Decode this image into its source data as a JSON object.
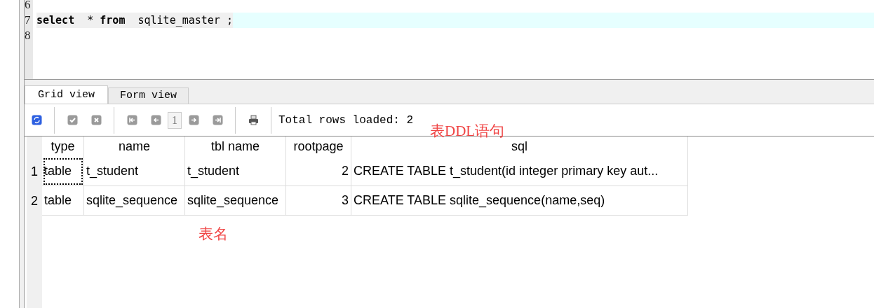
{
  "editor": {
    "lines": [
      {
        "number": "6",
        "current": false
      },
      {
        "number": "7",
        "current": true,
        "segments": [
          {
            "kind": "keyword",
            "text": "select"
          },
          {
            "kind": "plain",
            "text": "  * "
          },
          {
            "kind": "keyword",
            "text": "from"
          },
          {
            "kind": "plain",
            "text": "  sqlite_master ;"
          }
        ]
      },
      {
        "number": "8",
        "current": false
      }
    ]
  },
  "tabs": [
    {
      "label": "Grid view",
      "selected": true
    },
    {
      "label": "Form view",
      "selected": false
    }
  ],
  "toolbar": {
    "groups": [
      {
        "buttons": [
          {
            "kind": "refresh",
            "disabled": false
          }
        ]
      },
      {
        "buttons": [
          {
            "kind": "check",
            "disabled": true
          },
          {
            "kind": "cancel",
            "disabled": true
          }
        ]
      },
      {
        "buttons": [
          {
            "kind": "first",
            "disabled": true
          },
          {
            "kind": "prev",
            "disabled": true
          },
          {
            "kind": "page",
            "disabled": true,
            "value": "1"
          },
          {
            "kind": "next",
            "disabled": true
          },
          {
            "kind": "last",
            "disabled": true
          }
        ]
      },
      {
        "buttons": [
          {
            "kind": "print",
            "disabled": false
          }
        ]
      }
    ],
    "status": "Total rows loaded: 2"
  },
  "grid": {
    "columns": [
      "type",
      "name",
      "tbl name",
      "rootpage",
      "sql"
    ],
    "rows": [
      {
        "number": "1",
        "cells": [
          {
            "text": "table",
            "focused": true
          },
          {
            "text": "t_student",
            "focused": false
          },
          {
            "text": "t_student",
            "focused": false
          },
          {
            "text": "2",
            "focused": false
          },
          {
            "text": "CREATE TABLE t_student(id  integer primary key aut...",
            "focused": false
          }
        ]
      },
      {
        "number": "2",
        "cells": [
          {
            "text": "table",
            "focused": false
          },
          {
            "text": "sqlite_sequence",
            "focused": false
          },
          {
            "text": "sqlite_sequence",
            "focused": false
          },
          {
            "text": "3",
            "focused": false
          },
          {
            "text": "CREATE TABLE sqlite_sequence(name,seq)",
            "focused": false
          }
        ]
      }
    ]
  },
  "annotations": [
    {
      "kind": "sql",
      "text": "表DDL语句"
    },
    {
      "kind": "name",
      "text": "表名"
    }
  ]
}
